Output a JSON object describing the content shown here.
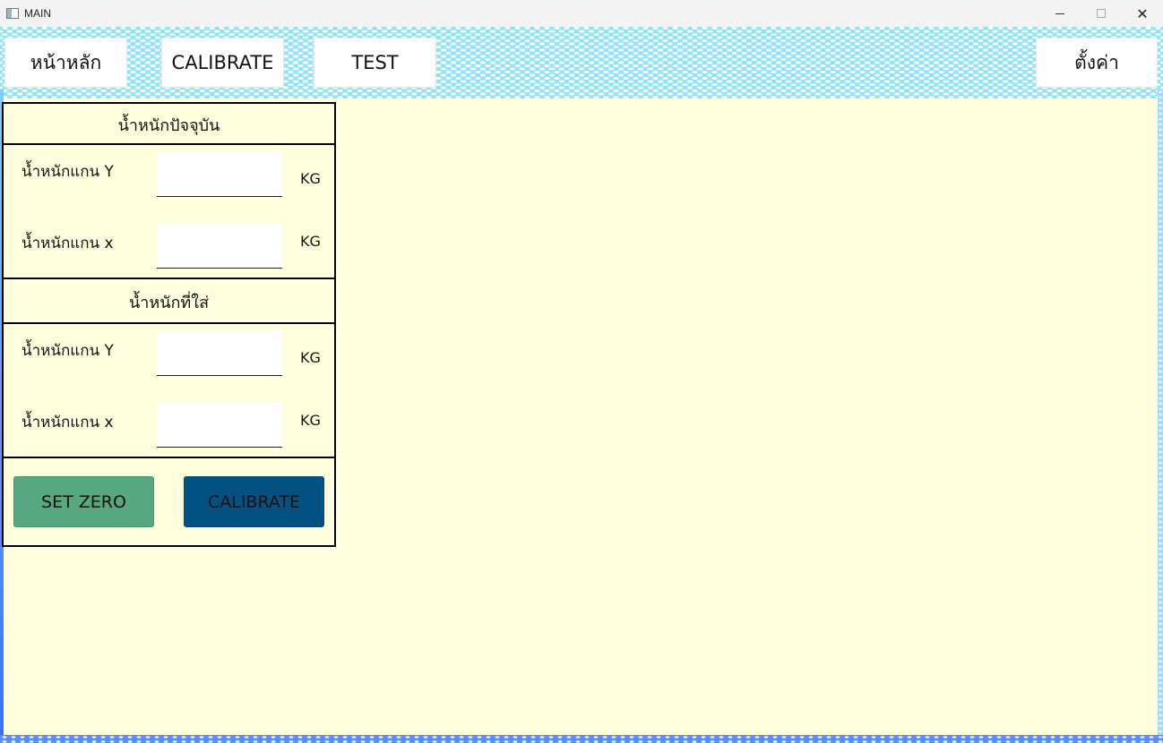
{
  "window": {
    "title": "MAIN",
    "minimize_glyph": "—",
    "close_glyph": "✕"
  },
  "nav": {
    "home": "หน้าหลัก",
    "calibrate": "CALIBRATE",
    "test": "TEST",
    "settings": "ตั้งค่า"
  },
  "current_weight": {
    "title": "น้ำหนักปัจจุบัน",
    "rows": [
      {
        "label": "น้ำหนักแกน Y",
        "value": "",
        "unit": "KG"
      },
      {
        "label": "น้ำหนักแกน x",
        "value": "",
        "unit": "KG"
      }
    ]
  },
  "applied_weight": {
    "title": "น้ำหนักที่ใส่",
    "rows": [
      {
        "label": "น้ำหนักแกน Y",
        "value": "",
        "unit": "KG"
      },
      {
        "label": "น้ำหนักแกน x",
        "value": "",
        "unit": "KG"
      }
    ]
  },
  "actions": {
    "set_zero": "SET ZERO",
    "calibrate": "CALIBRATE"
  },
  "colors": {
    "content_bg": "#ffffdd",
    "set_zero_bg": "#55a87f",
    "calibrate_bg": "#035282",
    "header_bg": "#8fe3f7"
  }
}
